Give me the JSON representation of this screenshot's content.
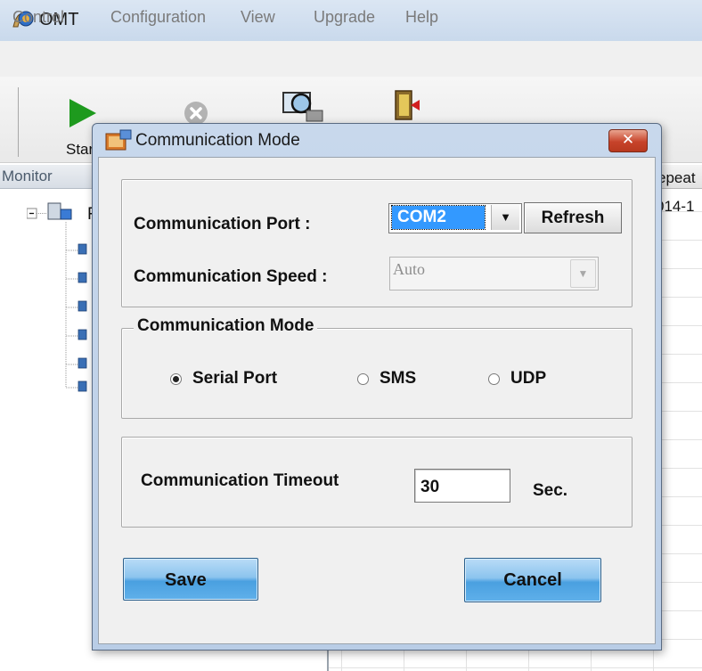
{
  "app": {
    "title": "OMT"
  },
  "menu": [
    "Control",
    "Configuration",
    "View",
    "Upgrade",
    "Help"
  ],
  "toolbar": {
    "start_label": "Star"
  },
  "monitor": {
    "header": "Monitor",
    "tree_root_letter": "R",
    "child_count": 6
  },
  "grid": {
    "column_label": "epeat",
    "first_cell": "014-1"
  },
  "dialog": {
    "title": "Communication Mode",
    "close_glyph": "✕",
    "port_label": "Communication Port :",
    "port_value": "COM2",
    "refresh_label": "Refresh",
    "speed_label": "Communication Speed :",
    "speed_value": "Auto",
    "mode_group_label": "Communication Mode",
    "modes": [
      {
        "label": "Serial Port",
        "checked": true
      },
      {
        "label": "SMS",
        "checked": false
      },
      {
        "label": "UDP",
        "checked": false
      }
    ],
    "timeout_label": "Communication Timeout",
    "timeout_value": "30",
    "timeout_unit": "Sec.",
    "save_label": "Save",
    "cancel_label": "Cancel"
  },
  "colors": {
    "selection": "#3399ff",
    "button_blue": "#5fb0ea",
    "close_red": "#c7432a",
    "start_green": "#1e9a1e"
  },
  "icons": [
    "app-logo-icon",
    "start-icon",
    "stop-icon",
    "monitor-search-icon",
    "exit-door-icon",
    "dialog-window-icon",
    "close-icon",
    "dropdown-arrow-icon",
    "network-node-icon"
  ]
}
